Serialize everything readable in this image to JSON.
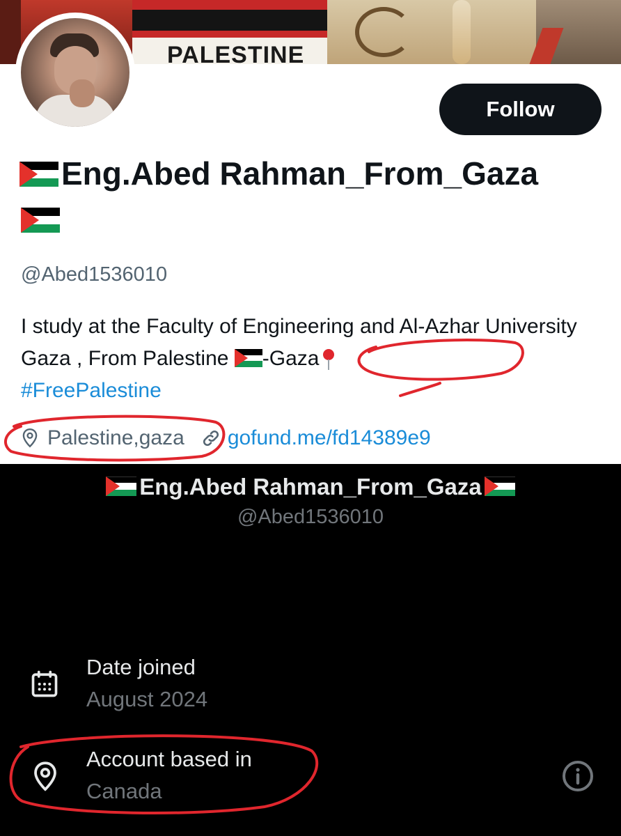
{
  "banner": {
    "text": "PALESTINE"
  },
  "header": {
    "follow_label": "Follow"
  },
  "profile": {
    "display_name": "Eng.Abed Rahman_From_Gaza",
    "handle": "@Abed1536010",
    "bio_part1": "I study at the Faculty of Engineering and Al-Azhar University Gaza , From Palestine ",
    "bio_part2": "-Gaza",
    "bio_hashtag": "#FreePalestine",
    "location": "Palestine,gaza",
    "website": "gofund.me/fd14389e9"
  },
  "about": {
    "display_name": "Eng.Abed Rahman_From_Gaza",
    "handle": "@Abed1536010",
    "date_joined_label": "Date joined",
    "date_joined_value": "August 2024",
    "based_label": "Account based in",
    "based_value": "Canada"
  },
  "icons": {
    "location": "location-pin-icon",
    "link": "link-icon",
    "calendar": "calendar-icon",
    "info": "info-icon",
    "pushpin": "pushpin-icon",
    "flag": "palestine-flag-icon"
  },
  "colors": {
    "follow_bg": "#0f1419",
    "link": "#1a8cd8",
    "secondary_text": "#536471",
    "dark_bg": "#000000",
    "annotation": "#e0262d",
    "flag_black": "#000000",
    "flag_white": "#ffffff",
    "flag_green": "#149954",
    "flag_red": "#e4312b"
  }
}
